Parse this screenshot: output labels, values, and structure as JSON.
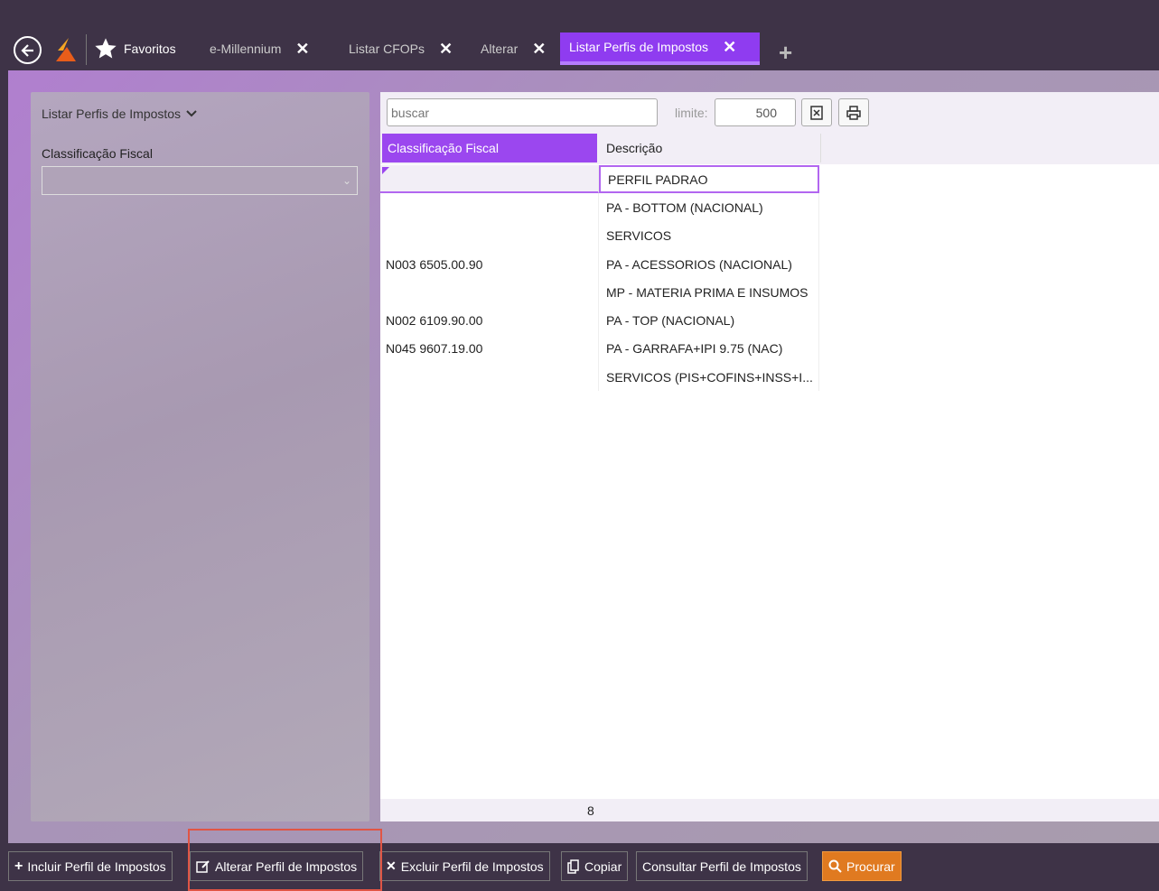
{
  "topbar": {
    "favorites_label": "Favoritos",
    "tabs": [
      {
        "label": "e-Millennium",
        "close": "✕"
      },
      {
        "label": "Listar CFOPs",
        "close": "✕"
      },
      {
        "label": "Alterar",
        "close": "✕"
      },
      {
        "label": "Listar Perfis de Impostos",
        "close": "✕"
      }
    ],
    "add_tab": "+"
  },
  "left_panel": {
    "title": "Listar Perfis de Impostos",
    "filter_label": "Classificação Fiscal",
    "filter_value": ""
  },
  "right_panel": {
    "search_placeholder": "buscar",
    "limit_label": "limite:",
    "limit_value": "500",
    "columns": [
      "Classificação Fiscal",
      "Descrição"
    ],
    "rows": [
      {
        "class": "",
        "desc": "PERFIL PADRAO"
      },
      {
        "class": "",
        "desc": "PA - BOTTOM (NACIONAL)"
      },
      {
        "class": "",
        "desc": "SERVICOS"
      },
      {
        "class": "N003 6505.00.90",
        "desc": "PA - ACESSORIOS (NACIONAL)"
      },
      {
        "class": "",
        "desc": "MP - MATERIA PRIMA E INSUMOS"
      },
      {
        "class": "N002 6109.90.00",
        "desc": "PA - TOP (NACIONAL)"
      },
      {
        "class": "N045 9607.19.00",
        "desc": "PA - GARRAFA+IPI 9.75 (NAC)"
      },
      {
        "class": "",
        "desc": "SERVICOS (PIS+COFINS+INSS+I..."
      }
    ],
    "row_count": "8"
  },
  "actions": {
    "include": "Incluir Perfil de Impostos",
    "alter": "Alterar Perfil de Impostos",
    "delete": "Excluir Perfil de Impostos",
    "copy": "Copiar",
    "consult": "Consultar Perfil de Impostos",
    "search": "Procurar"
  },
  "colors": {
    "accent": "#9b47ef",
    "primary_action": "#e07a20",
    "topbar": "#3e3347"
  }
}
